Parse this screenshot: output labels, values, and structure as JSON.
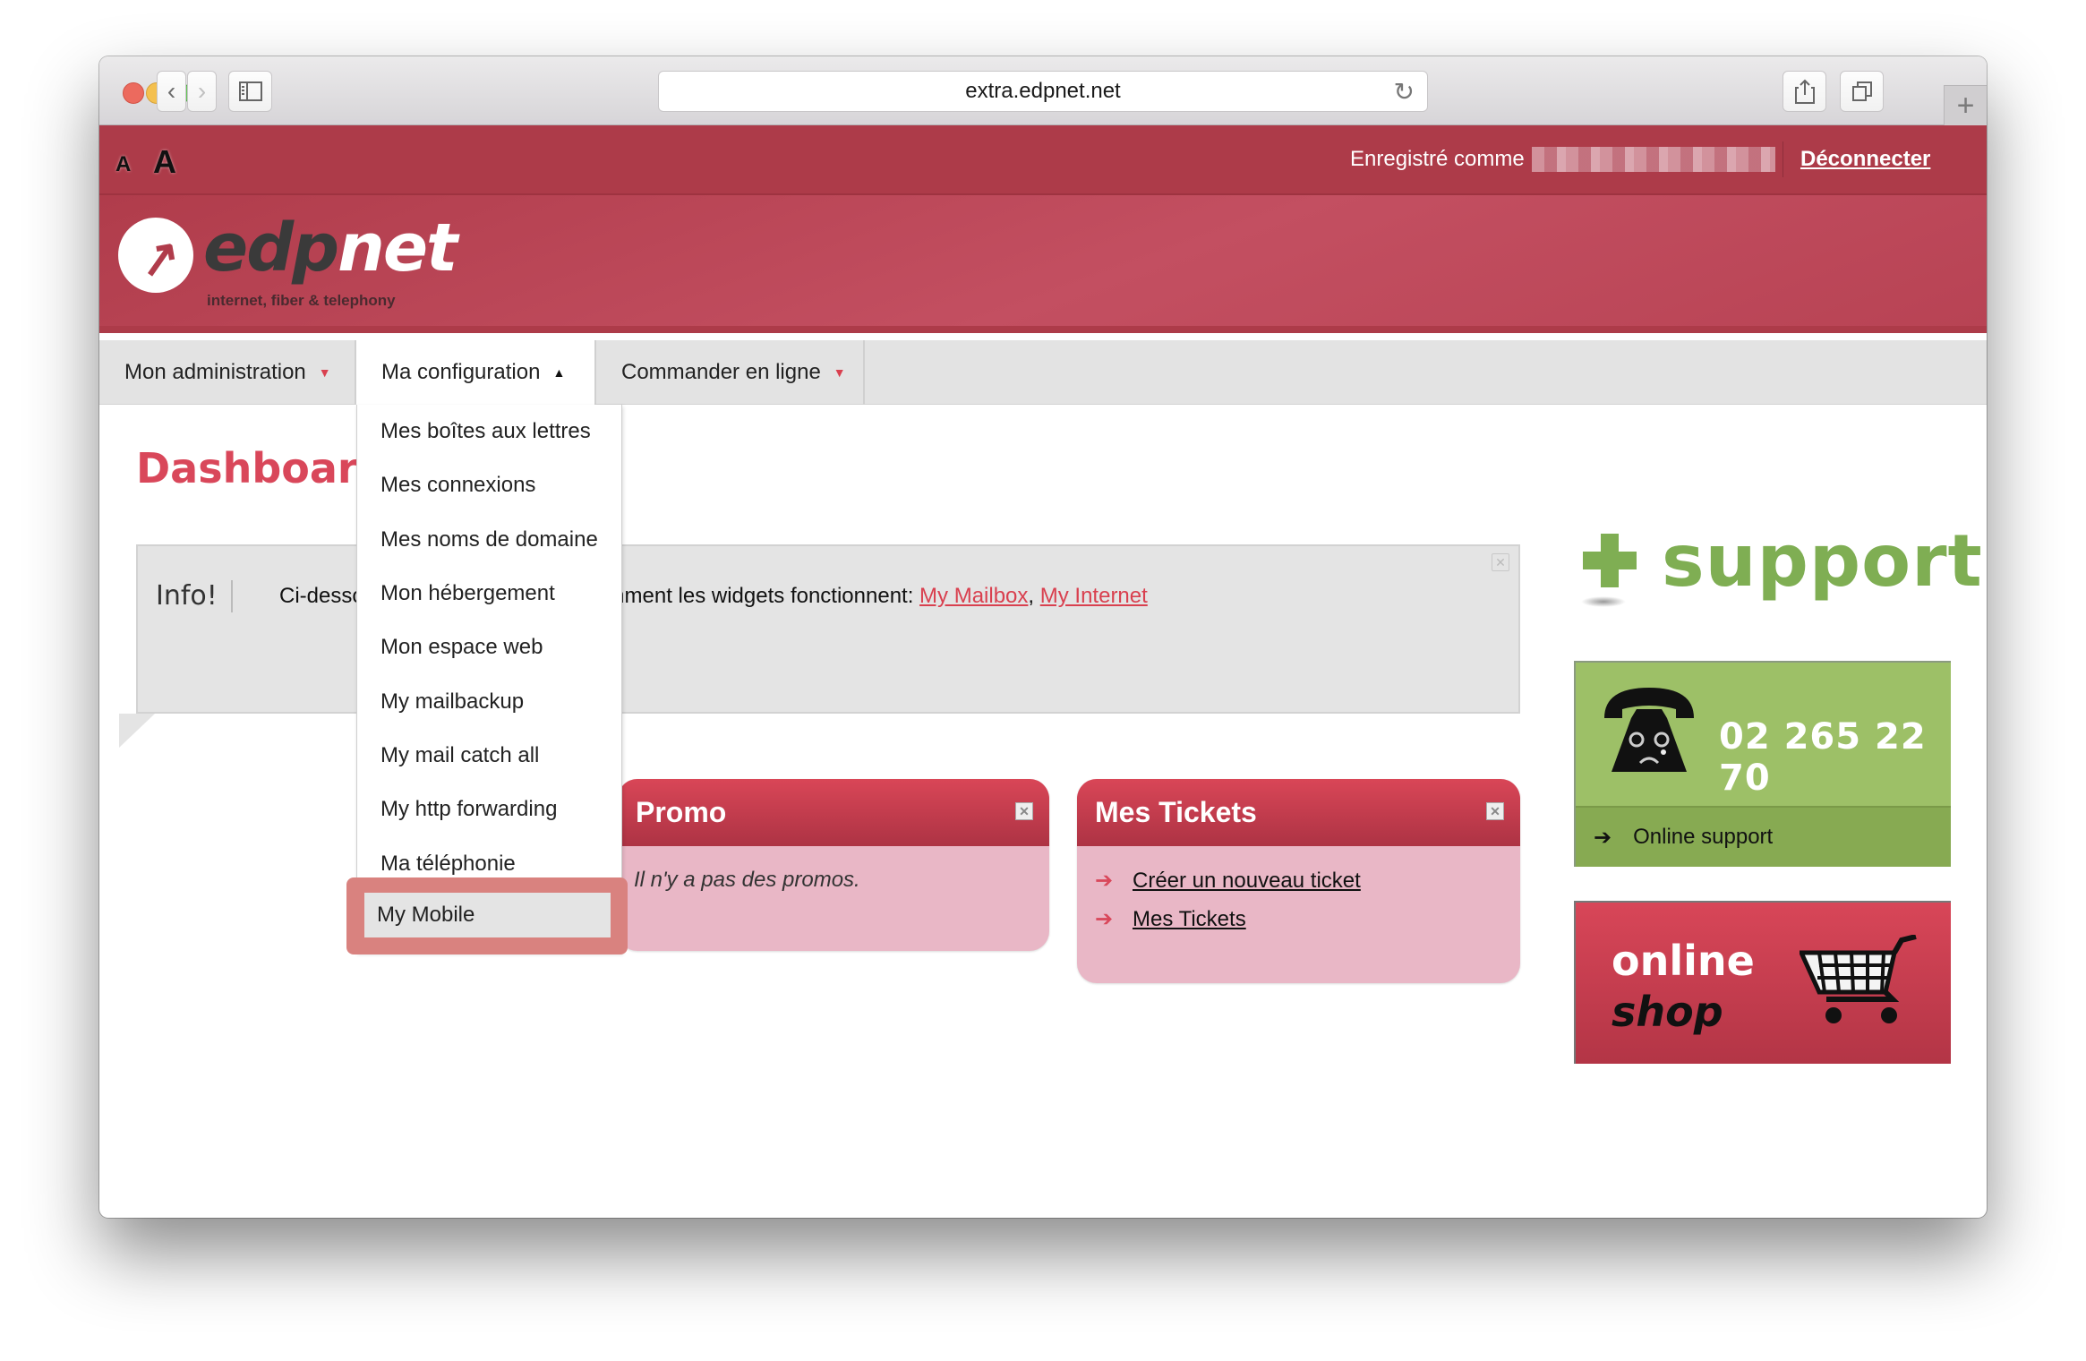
{
  "browser": {
    "url": "extra.edpnet.net",
    "back_icon": "‹",
    "forward_icon": "›",
    "new_tab_icon": "+"
  },
  "topbar": {
    "font_small": "A",
    "font_large": "A",
    "logged_in_label": "Enregistré comme",
    "logout_label": "Déconnecter"
  },
  "header": {
    "logo_part1": "edp",
    "logo_part2": "net",
    "tagline": "internet, fiber & telephony"
  },
  "nav": {
    "items": [
      {
        "label": "Mon administration",
        "caret": "▼"
      },
      {
        "label": "Ma configuration",
        "caret": "▲"
      },
      {
        "label": "Commander en ligne",
        "caret": "▼"
      }
    ]
  },
  "dropdown": {
    "items": [
      "Mes boîtes aux lettres",
      "Mes connexions",
      "Mes noms de domaine",
      "Mon hébergement",
      "Mon espace web",
      "My mailbackup",
      "My mail catch all",
      "My http forwarding",
      "Ma téléphonie"
    ],
    "selected": "My Mobile"
  },
  "main": {
    "title": "Dashboard",
    "info": {
      "label": "Info!",
      "text_start": "Ci-dessous quelques exemples comment les widgets fonctionnent: ",
      "link1": "My Mailbox",
      "separator": ", ",
      "link2": "My Internet",
      "close_icon": "✕"
    },
    "promo": {
      "title": "Promo",
      "body": "Il n'y a pas des promos.",
      "close_icon": "✕"
    },
    "tickets": {
      "title": "Mes Tickets",
      "close_icon": "✕",
      "links": [
        "Créer un nouveau ticket",
        "Mes Tickets"
      ],
      "arrow": "➔"
    }
  },
  "sidebar": {
    "support_title": "support",
    "phone_number": "02  265 22 70",
    "online_support": "Online support",
    "arrow": "➔",
    "shop_line1": "online",
    "shop_line2": "shop"
  },
  "colors": {
    "brand_red": "#ad3b49",
    "accent_red": "#d9475a",
    "support_green": "#9dc067",
    "widget_body": "#e9b7c6"
  }
}
